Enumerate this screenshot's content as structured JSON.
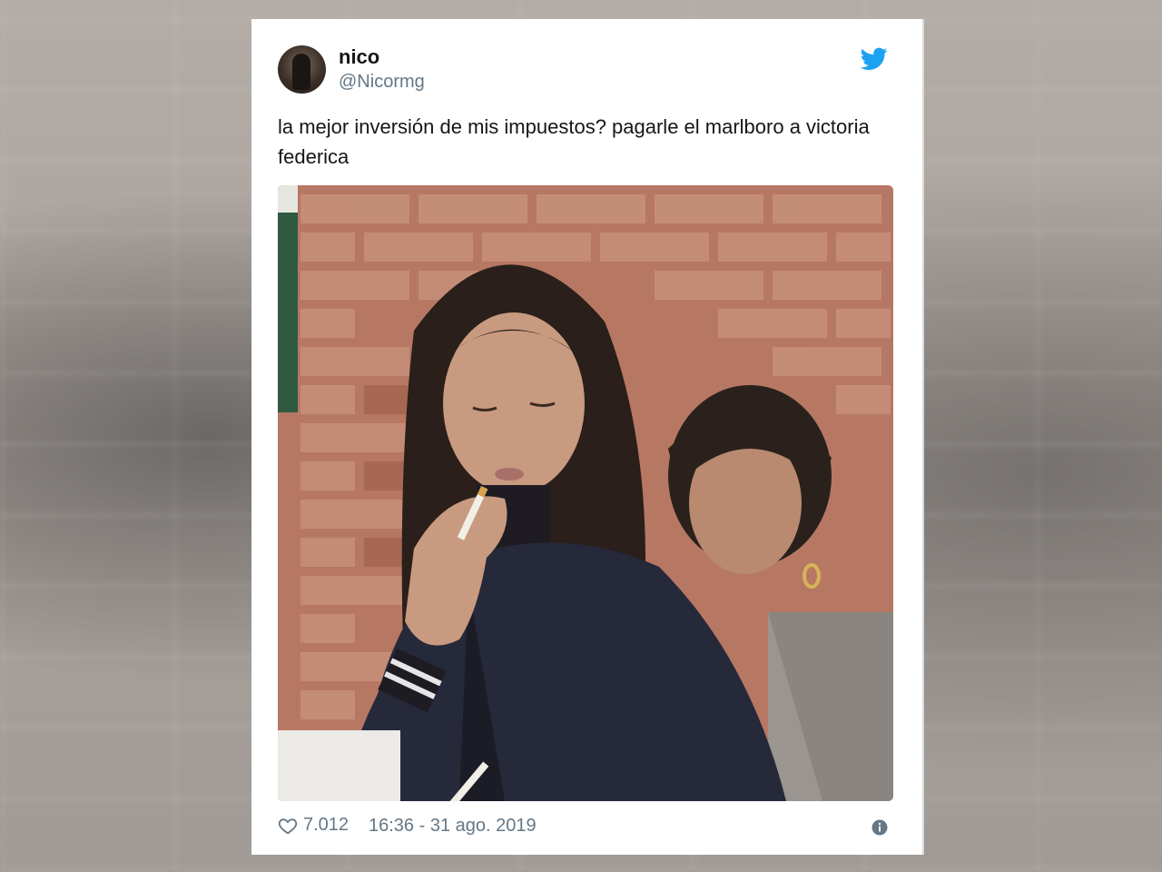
{
  "tweet": {
    "author_name": "nico",
    "author_handle": "@Nicormg",
    "text": "la mejor inversión de mis impuestos? pagarle el marlboro a victoria federica",
    "likes": "7.012",
    "timestamp": "16:36 - 31 ago. 2019"
  },
  "icons": {
    "brand": "twitter-bird-icon",
    "like": "heart-icon",
    "info": "info-icon"
  },
  "colors": {
    "brand": "#1da1f2",
    "text": "#14171a",
    "secondary": "#657786"
  }
}
